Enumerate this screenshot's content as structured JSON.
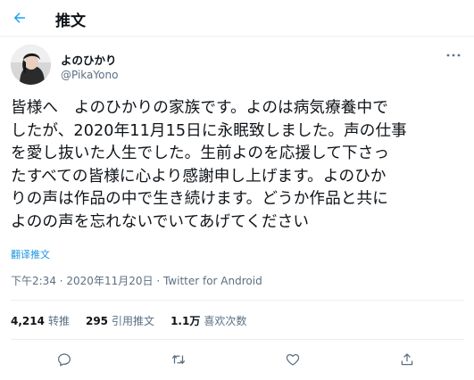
{
  "header": {
    "back_icon": "arrow-left-icon",
    "title": "推文"
  },
  "author": {
    "display_name": "よのひかり",
    "handle": "@PikaYono"
  },
  "tweet": {
    "text": "皆様へ　よのひかりの家族です。よのは病気療養中で\nしたが、2020年11月15日に永眠致しました。声の仕事\nを愛し抜いた人生でした。生前よのを応援して下さっ\nたすべての皆様に心より感謝申し上げます。よのひか\nりの声は作品の中で生き続けます。どうか作品と共に\nよのの声を忘れないでいてあげてください",
    "translate_label": "翻译推文"
  },
  "meta": {
    "time": "下午2:34",
    "separator1": " · ",
    "date": "2020年11月20日",
    "separator2": " · ",
    "source": "Twitter for Android"
  },
  "stats": {
    "retweets_count": "4,214",
    "retweets_label": "转推",
    "quotes_count": "295",
    "quotes_label": "引用推文",
    "likes_count": "1.1万",
    "likes_label": "喜欢次数"
  },
  "colors": {
    "accent": "#1da1f2",
    "text_primary": "#0f1419",
    "text_secondary": "#5b7083",
    "divider": "#ebeef0"
  },
  "actions": [
    "reply-icon",
    "retweet-icon",
    "like-icon",
    "share-icon"
  ]
}
